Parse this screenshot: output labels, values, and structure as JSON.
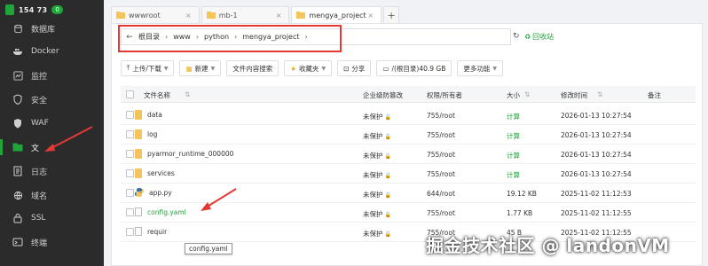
{
  "sidebar": {
    "server_ip": "154 73",
    "badge": "0",
    "items": [
      {
        "label": "数据库",
        "icon": "database-icon"
      },
      {
        "label": "Docker",
        "icon": "docker-icon"
      },
      {
        "label": "监控",
        "icon": "monitor-icon"
      },
      {
        "label": "安全",
        "icon": "shield-icon"
      },
      {
        "label": "WAF",
        "icon": "waf-icon"
      },
      {
        "label": "文",
        "icon": "folder-icon"
      },
      {
        "label": "日志",
        "icon": "log-icon"
      },
      {
        "label": "域名",
        "icon": "globe-icon"
      },
      {
        "label": "SSL",
        "icon": "ssl-icon"
      },
      {
        "label": "终端",
        "icon": "terminal-icon"
      }
    ]
  },
  "tabs": [
    {
      "label": "wwwroot"
    },
    {
      "label": "mb-1"
    },
    {
      "label": "mengya_project"
    }
  ],
  "path": {
    "crumbs": [
      "根目录",
      "www",
      "python",
      "mengya_project"
    ],
    "recycle_label": "回收站"
  },
  "toolbar": {
    "upload": "上传/下载",
    "new": "新建",
    "search_content": "文件内容搜索",
    "favorites": "收藏夹",
    "share": "分享",
    "disk": "/(根目录)40.9 GB",
    "more": "更多功能"
  },
  "table": {
    "headers": {
      "name": "文件名称",
      "protect": "企业级防篡改",
      "perm": "权限/所有者",
      "size": "大小",
      "mtime": "修改时间",
      "note": "备注"
    },
    "rows": [
      {
        "name": "data",
        "type": "folder",
        "protect": "未保护",
        "perm": "755/root",
        "size": "计算",
        "mtime": "2026-01-13 10:27:54"
      },
      {
        "name": "log",
        "type": "folder",
        "protect": "未保护",
        "perm": "755/root",
        "size": "计算",
        "mtime": "2026-01-13 10:27:54"
      },
      {
        "name": "pyarmor_runtime_000000",
        "type": "folder",
        "protect": "未保护",
        "perm": "755/root",
        "size": "计算",
        "mtime": "2026-01-13 10:27:54"
      },
      {
        "name": "services",
        "type": "folder",
        "protect": "未保护",
        "perm": "755/root",
        "size": "计算",
        "mtime": "2026-01-13 10:27:54"
      },
      {
        "name": "app.py",
        "type": "python",
        "protect": "未保护",
        "perm": "644/root",
        "size": "19.12 KB",
        "mtime": "2025-11-02 11:12:53"
      },
      {
        "name": "config.yaml",
        "type": "file",
        "protect": "未保护",
        "perm": "755/root",
        "size": "1.77 KB",
        "mtime": "2025-11-02 11:12:55"
      },
      {
        "name": "requir",
        "type": "file",
        "protect": "未保护",
        "perm": "755/root",
        "size": "45 B",
        "mtime": "2025-11-02 11:12:55"
      }
    ]
  },
  "tooltip": "config.yaml",
  "watermark": "掘金技术社区 @ landonVM",
  "colors": {
    "accent": "#20a53a",
    "annotation": "#e53935",
    "sidebar": "#2b2b2b"
  }
}
